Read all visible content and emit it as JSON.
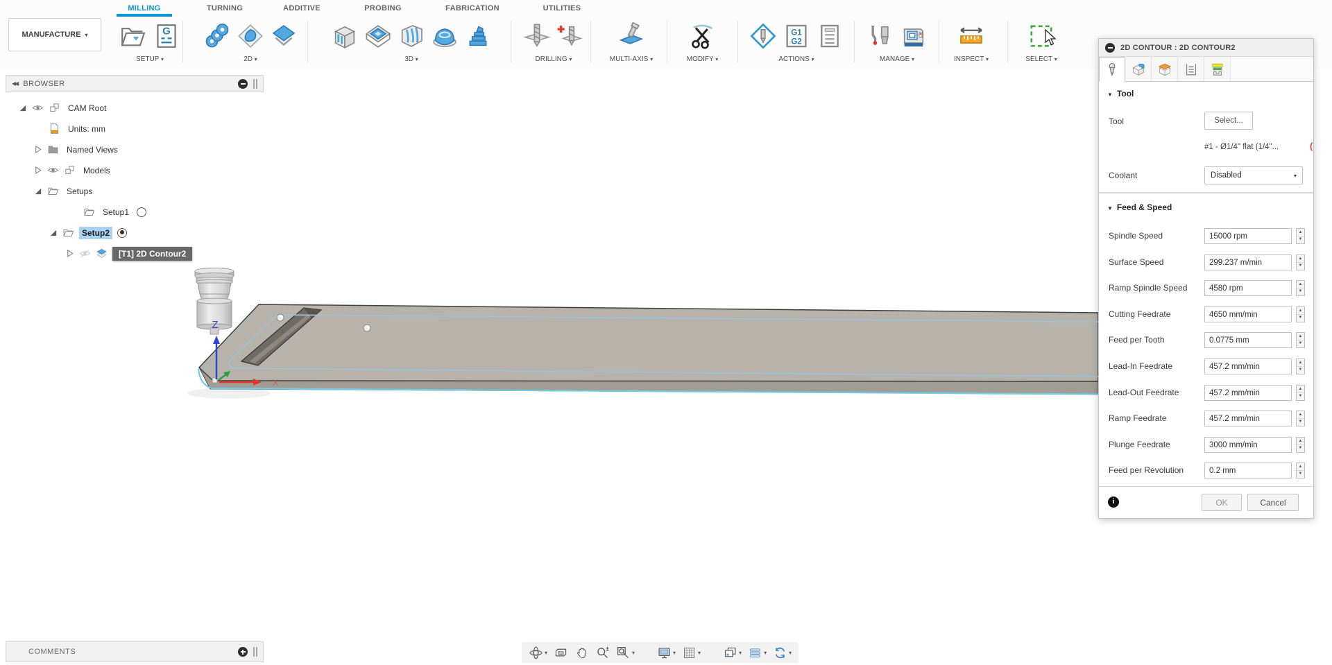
{
  "workspace": {
    "label": "MANUFACTURE"
  },
  "tabs": {
    "items": [
      "MILLING",
      "TURNING",
      "ADDITIVE",
      "PROBING",
      "FABRICATION",
      "UTILITIES"
    ],
    "active": "MILLING"
  },
  "colors": {
    "accent": "#0696d7",
    "selection_highlight": "#a9d2f3",
    "stock_outline": "#74cae4",
    "contour_line": "#9cc3d6",
    "plate_top": "#b7b3aa",
    "plate_front": "#a19d94"
  },
  "ribbon": {
    "groups": [
      {
        "label": "SETUP",
        "icons": [
          "setup-folder-icon",
          "gcode-doc-icon"
        ]
      },
      {
        "label": "2D",
        "icons": [
          "2d-adaptive-icon",
          "2d-pocket-icon",
          "2d-contour-icon"
        ]
      },
      {
        "label": "3D",
        "icons": [
          "3d-adaptive-icon",
          "3d-pocket-icon",
          "3d-contour-icon",
          "3d-scallop-icon",
          "3d-ramp-icon"
        ]
      },
      {
        "label": "DRILLING",
        "icons": [
          "drill-icon",
          "drill-add-icon"
        ]
      },
      {
        "label": "MULTI-AXIS",
        "icons": [
          "multi-axis-icon"
        ]
      },
      {
        "label": "MODIFY",
        "icons": [
          "trim-icon"
        ]
      },
      {
        "label": "ACTIONS",
        "icons": [
          "post-process-icon",
          "gcode-g1g2-icon",
          "setup-sheet-icon"
        ]
      },
      {
        "label": "MANAGE",
        "icons": [
          "tool-library-icon",
          "machine-library-icon"
        ]
      },
      {
        "label": "INSPECT",
        "icons": [
          "measure-icon"
        ]
      },
      {
        "label": "SELECT",
        "icons": [
          "window-select-icon"
        ]
      }
    ]
  },
  "browser": {
    "title": "BROWSER",
    "rows": [
      {
        "name": "cam-root",
        "label": "CAM Root",
        "expander": "expanded",
        "icons": [
          "eye-icon",
          "component-icon"
        ]
      },
      {
        "name": "units",
        "label": "Units: mm",
        "expander": null,
        "icons": [
          "units-doc-icon"
        ]
      },
      {
        "name": "named-views",
        "label": "Named Views",
        "expander": "collapsed",
        "icons": [
          "folder-icon"
        ]
      },
      {
        "name": "models",
        "label": "Models",
        "expander": "collapsed",
        "icons": [
          "eye-icon",
          "component-icon"
        ]
      },
      {
        "name": "setups",
        "label": "Setups",
        "expander": "expanded",
        "icons": [
          "open-folder-icon"
        ]
      },
      {
        "name": "setup1",
        "label": "Setup1",
        "expander": null,
        "icons": [
          "open-folder-icon"
        ],
        "trailing": "radio-empty"
      },
      {
        "name": "setup2",
        "label": "Setup2",
        "expander": "expanded",
        "icons": [
          "open-folder-icon"
        ],
        "trailing": "radio-active",
        "selected": true
      },
      {
        "name": "t1-2d-contour2",
        "label": "[T1] 2D Contour2",
        "expander": "collapsed",
        "icons": [
          "hidden-eye-icon",
          "contour-op-icon"
        ],
        "editing": true
      }
    ]
  },
  "viewport": {
    "z_axis_label": "Z",
    "x_axis_label": "X"
  },
  "dialog": {
    "title": "2D CONTOUR : 2D CONTOUR2",
    "tabs": [
      {
        "name": "tab-tool",
        "icon": "tool-tab-icon",
        "active": true
      },
      {
        "name": "tab-geometry",
        "icon": "geometry-tab-icon",
        "active": false
      },
      {
        "name": "tab-heights",
        "icon": "heights-tab-icon",
        "active": false
      },
      {
        "name": "tab-passes",
        "icon": "passes-tab-icon",
        "active": false
      },
      {
        "name": "tab-linking",
        "icon": "linking-tab-icon",
        "active": false
      }
    ],
    "tool": {
      "header": "Tool",
      "tool_label": "Tool",
      "tool_button": "Select...",
      "tool_desc": "#1 - Ø1/4\" flat (1/4\"...",
      "coolant_label": "Coolant",
      "coolant_value": "Disabled"
    },
    "feed": {
      "header": "Feed & Speed",
      "rows": [
        {
          "name": "spindle-speed",
          "label": "Spindle Speed",
          "value": "15000 rpm"
        },
        {
          "name": "surface-speed",
          "label": "Surface Speed",
          "value": "299.237 m/min"
        },
        {
          "name": "ramp-spindle-speed",
          "label": "Ramp Spindle Speed",
          "value": "4580 rpm"
        },
        {
          "name": "cutting-feedrate",
          "label": "Cutting Feedrate",
          "value": "4650 mm/min"
        },
        {
          "name": "feed-per-tooth",
          "label": "Feed per Tooth",
          "value": "0.0775 mm"
        },
        {
          "name": "lead-in-feedrate",
          "label": "Lead-In Feedrate",
          "value": "457.2 mm/min"
        },
        {
          "name": "lead-out-feedrate",
          "label": "Lead-Out Feedrate",
          "value": "457.2 mm/min"
        },
        {
          "name": "ramp-feedrate",
          "label": "Ramp Feedrate",
          "value": "457.2 mm/min"
        },
        {
          "name": "plunge-feedrate",
          "label": "Plunge Feedrate",
          "value": "3000 mm/min"
        },
        {
          "name": "feed-per-revolution",
          "label": "Feed per Revolution",
          "value": "0.2 mm"
        }
      ]
    },
    "ok": "OK",
    "cancel": "Cancel"
  },
  "comments": {
    "label": "COMMENTS"
  },
  "nav": {
    "icons": [
      {
        "name": "orbit-icon",
        "caret": true
      },
      {
        "name": "look-at-icon",
        "caret": false
      },
      {
        "name": "pan-icon",
        "caret": false
      },
      {
        "name": "zoom-icon",
        "caret": false
      },
      {
        "name": "fit-icon",
        "caret": true
      },
      {
        "name": "display-settings-icon",
        "caret": true,
        "gap_before": true
      },
      {
        "name": "grid-snaps-icon",
        "caret": true
      },
      {
        "name": "viewports-icon",
        "caret": true,
        "gap_before": true
      },
      {
        "name": "steps-icon",
        "caret": true
      },
      {
        "name": "refresh-icon",
        "caret": true
      }
    ]
  }
}
